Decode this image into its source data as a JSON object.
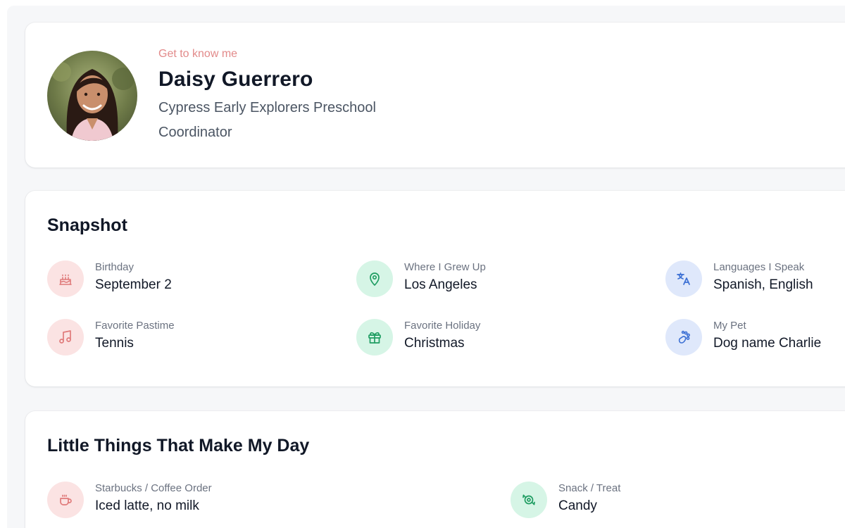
{
  "profile": {
    "eyebrow": "Get to know me",
    "name": "Daisy Guerrero",
    "school": "Cypress Early Explorers Preschool",
    "role": "Coordinator"
  },
  "snapshot": {
    "title": "Snapshot",
    "items": [
      {
        "label": "Birthday",
        "value": "September 2",
        "icon": "cake-icon",
        "color": "#e07b7b"
      },
      {
        "label": "Where I Grew Up",
        "value": "Los Angeles",
        "icon": "map-pin-icon",
        "color": "#1f9d62"
      },
      {
        "label": "Languages I Speak",
        "value": "Spanish, English",
        "icon": "translate-icon",
        "color": "#3b6fd4"
      },
      {
        "label": "Favorite Pastime",
        "value": "Tennis",
        "icon": "music-note-icon",
        "color": "#e07b7b"
      },
      {
        "label": "Favorite Holiday",
        "value": "Christmas",
        "icon": "gift-icon",
        "color": "#1f9d62"
      },
      {
        "label": "My Pet",
        "value": "Dog name Charlie",
        "icon": "paw-icon",
        "color": "#3b6fd4"
      }
    ]
  },
  "little_things": {
    "title": "Little Things That Make My Day",
    "items": [
      {
        "label": "Starbucks / Coffee Order",
        "value": "Iced latte, no milk",
        "icon": "coffee-icon",
        "color": "#e07b7b"
      },
      {
        "label": "Snack / Treat",
        "value": "Candy",
        "icon": "candy-icon",
        "color": "#1f9d62"
      }
    ]
  },
  "colors": {
    "accent_pink": "#e28a8a",
    "pink_bg": "#fbe3e3",
    "green_bg": "#d6f5e6",
    "blue_bg": "#dfe8fb"
  }
}
